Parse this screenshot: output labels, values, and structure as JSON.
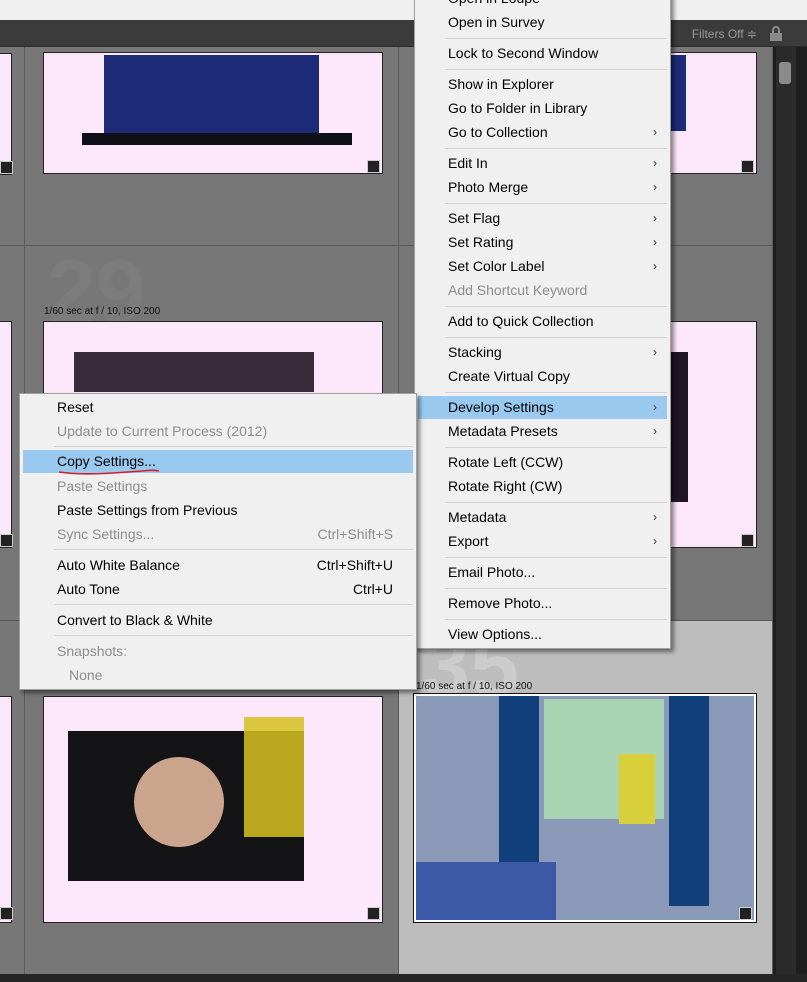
{
  "toolbar": {
    "filters_label": "Filters Off ≑"
  },
  "grid": {
    "cells": [
      {
        "number": "",
        "meta": ""
      },
      {
        "number": "29",
        "meta": "1/60 sec at f / 10, ISO 200"
      },
      {
        "number": "",
        "meta": ""
      },
      {
        "number": "35",
        "meta": "1/60 sec at f / 10, ISO 200"
      }
    ]
  },
  "context_menu": {
    "items": [
      {
        "label": "Open in Loupe"
      },
      {
        "label": "Open in Survey"
      },
      {
        "label": "Lock to Second Window"
      },
      {
        "label": "Show in Explorer"
      },
      {
        "label": "Go to Folder in Library"
      },
      {
        "label": "Go to Collection",
        "arrow": "›"
      },
      {
        "label": "Edit In",
        "arrow": "›"
      },
      {
        "label": "Photo Merge",
        "arrow": "›"
      },
      {
        "label": "Set Flag",
        "arrow": "›"
      },
      {
        "label": "Set Rating",
        "arrow": "›"
      },
      {
        "label": "Set Color Label",
        "arrow": "›"
      },
      {
        "label": "Add Shortcut Keyword"
      },
      {
        "label": "Add to Quick Collection"
      },
      {
        "label": "Stacking",
        "arrow": "›"
      },
      {
        "label": "Create Virtual Copy"
      },
      {
        "label": "Develop Settings",
        "arrow": "›"
      },
      {
        "label": "Metadata Presets",
        "arrow": "›"
      },
      {
        "label": "Rotate Left (CCW)"
      },
      {
        "label": "Rotate Right (CW)"
      },
      {
        "label": "Metadata",
        "arrow": "›"
      },
      {
        "label": "Export",
        "arrow": "›"
      },
      {
        "label": "Email Photo..."
      },
      {
        "label": "Remove Photo..."
      },
      {
        "label": "View Options..."
      }
    ]
  },
  "develop_submenu": {
    "items": [
      {
        "label": "Reset"
      },
      {
        "label": "Update to Current Process (2012)"
      },
      {
        "label": "Copy Settings..."
      },
      {
        "label": "Paste Settings"
      },
      {
        "label": "Paste Settings from Previous"
      },
      {
        "label": "Sync Settings...",
        "shortcut": "Ctrl+Shift+S"
      },
      {
        "label": "Auto White Balance",
        "shortcut": "Ctrl+Shift+U"
      },
      {
        "label": "Auto Tone",
        "shortcut": "Ctrl+U"
      },
      {
        "label": "Convert to Black & White"
      },
      {
        "label": "Snapshots:"
      },
      {
        "label": "None"
      }
    ]
  },
  "colors": {
    "highlight": "#99c9ef",
    "menu_bg": "#f0f0f0",
    "thumb_bg": "#fde7fb",
    "annotation": "#d0202a"
  }
}
